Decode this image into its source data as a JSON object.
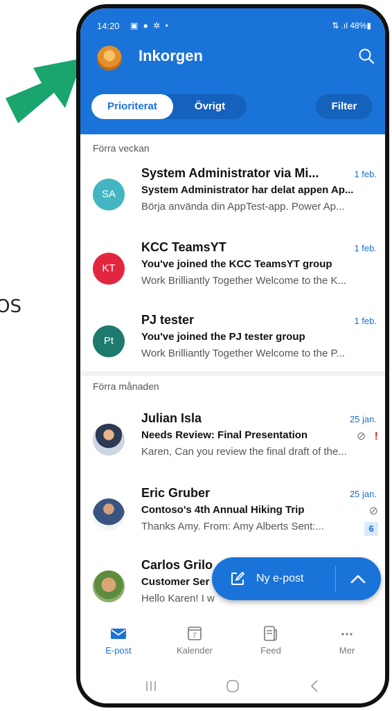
{
  "outside_text": "OS",
  "status": {
    "time": "14:20",
    "icons": "▣ ● ✲ •",
    "right": "⇅ .ıl 48%▮"
  },
  "header": {
    "title": "Inkorgen",
    "tabs": [
      "Prioriterat",
      "Övrigt"
    ],
    "filter": "Filter"
  },
  "sections": [
    "Förra veckan",
    "Förra månaden"
  ],
  "emails": [
    {
      "initials": "SA",
      "color": "#43b6c2",
      "sender": "System Administrator via Mi...",
      "date": "1 feb.",
      "subject": "System Administrator har delat appen Ap...",
      "preview": "Börja använda din AppTest-app. Power Ap..."
    },
    {
      "initials": "KT",
      "color": "#e3263f",
      "sender": "KCC TeamsYT",
      "date": "1 feb.",
      "subject": "You've joined the KCC TeamsYT group",
      "preview": "Work Brilliantly Together Welcome to the K..."
    },
    {
      "initials": "Pt",
      "color": "#1e7a6e",
      "sender": "PJ tester",
      "date": "1 feb.",
      "subject": "You've joined the PJ tester group",
      "preview": "Work Brilliantly Together Welcome to the P..."
    },
    {
      "sender": "Julian Isla",
      "date": "25 jan.",
      "subject": "Needs Review: Final Presentation",
      "preview": "Karen, Can you review the final draft of the...",
      "attachment": "⊘",
      "important": "!"
    },
    {
      "sender": "Eric Gruber",
      "date": "25 jan.",
      "subject": "Contoso's 4th Annual Hiking Trip",
      "preview": "Thanks Amy. From: Amy Alberts Sent:...",
      "attachment": "⊘",
      "count": "6"
    },
    {
      "sender": "Carlos Grilo",
      "subject": "Customer Ser",
      "preview": "Hello Karen! I w"
    }
  ],
  "fab": {
    "label": "Ny e-post"
  },
  "tabbar": [
    {
      "label": "E-post",
      "active": true
    },
    {
      "label": "Kalender",
      "day": "7"
    },
    {
      "label": "Feed"
    },
    {
      "label": "Mer"
    }
  ],
  "colors": {
    "brand": "#1a73d9",
    "arrow": "#1aa56e"
  }
}
